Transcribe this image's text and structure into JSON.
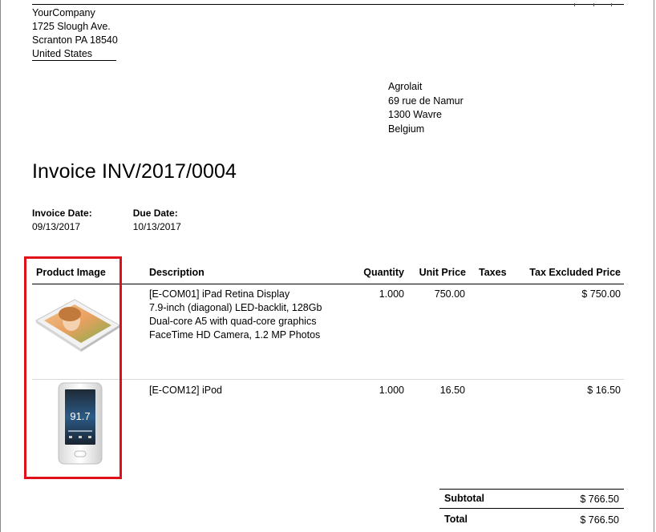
{
  "company": {
    "name": "YourCompany",
    "street": "1725 Slough Ave.",
    "city": "Scranton PA 18540",
    "country": "United States"
  },
  "customer": {
    "name": "Agrolait",
    "street": "69 rue de Namur",
    "city": "1300 Wavre",
    "country": "Belgium"
  },
  "invoice": {
    "title": "Invoice INV/2017/0004",
    "date_label": "Invoice Date:",
    "date_value": "09/13/2017",
    "due_label": "Due Date:",
    "due_value": "10/13/2017"
  },
  "table": {
    "headers": {
      "image": "Product Image",
      "description": "Description",
      "quantity": "Quantity",
      "unit_price": "Unit Price",
      "taxes": "Taxes",
      "tax_excluded": "Tax Excluded Price"
    },
    "rows": [
      {
        "image_icon": "ipad-product-image",
        "desc_lines": [
          "[E-COM01] iPad Retina Display",
          "7.9-inch (diagonal) LED-backlit, 128Gb",
          "Dual-core A5 with quad-core graphics",
          "FaceTime HD Camera, 1.2 MP Photos"
        ],
        "quantity": "1.000",
        "unit_price": "750.00",
        "taxes": "",
        "amount": "$ 750.00"
      },
      {
        "image_icon": "ipod-product-image",
        "desc_lines": [
          "[E-COM12] iPod"
        ],
        "quantity": "1.000",
        "unit_price": "16.50",
        "taxes": "",
        "amount": "$ 16.50",
        "screen_text": "91.7"
      }
    ]
  },
  "totals": {
    "subtotal_label": "Subtotal",
    "subtotal_value": "$ 766.50",
    "total_label": "Total",
    "total_value": "$ 766.50"
  },
  "colors": {
    "highlight": "#e0101a",
    "rule": "#000000",
    "row_rule": "#d9d9d9"
  }
}
